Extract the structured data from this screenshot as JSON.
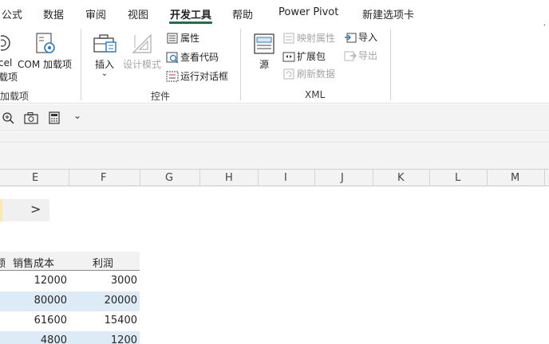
{
  "tabs": [
    "公式",
    "数据",
    "审阅",
    "视图",
    "开发工具",
    "帮助",
    "Power Pivot",
    "新建选项卡"
  ],
  "active_tab": "开发工具",
  "ribbon": {
    "addins": {
      "excel_line1": "cel",
      "excel_line2": "载项",
      "com_label": "COM 加载项",
      "group_label": "加载项"
    },
    "controls": {
      "insert_label": "插入",
      "design_mode_label": "设计模式",
      "properties_label": "属性",
      "view_code_label": "查看代码",
      "run_dialog_label": "运行对话框",
      "group_label": "控件"
    },
    "xml": {
      "source_label": "源",
      "map_properties_label": "映射属性",
      "expansion_packs_label": "扩展包",
      "refresh_data_label": "刷新数据",
      "import_label": "导入",
      "export_label": "导出",
      "group_label": "XML"
    }
  },
  "qat": {
    "icons": [
      "zoom-in-icon",
      "camera-icon",
      "calculator-icon",
      "customize-dropdown-icon"
    ],
    "chevron": "⌄"
  },
  "columns": [
    "E",
    "F",
    "G",
    "H",
    "I",
    "J",
    "K",
    "L",
    "M"
  ],
  "nav_arrow": ">",
  "table": {
    "headers": [
      "额",
      "销售成本",
      "利润"
    ],
    "rows": [
      {
        "cost": "12000",
        "profit": "3000"
      },
      {
        "cost": "80000",
        "profit": "20000"
      },
      {
        "cost": "61600",
        "profit": "15400"
      },
      {
        "cost": "4800",
        "profit": "1200"
      }
    ]
  },
  "colors": {
    "accent": "#1e7145",
    "band": "#ddebf7",
    "ribbon_bg": "#f3f3f3"
  }
}
